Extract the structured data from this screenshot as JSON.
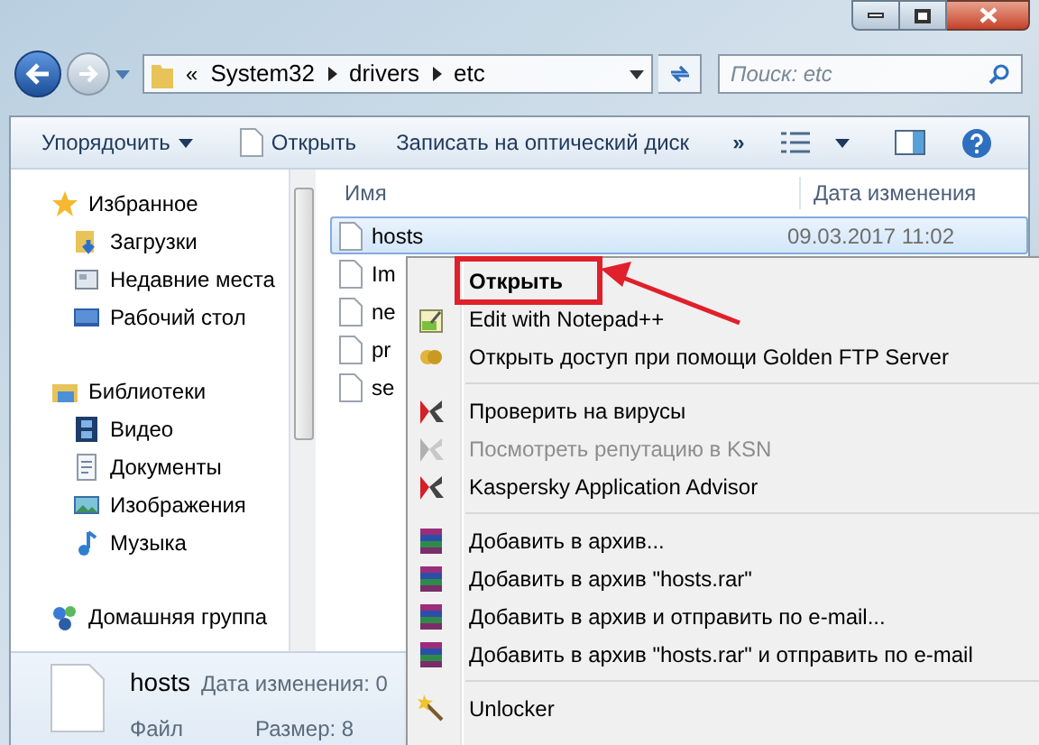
{
  "address": {
    "overflow": "«",
    "crumbs": [
      "System32",
      "drivers",
      "etc"
    ]
  },
  "search": {
    "placeholder": "Поиск: etc"
  },
  "toolbar": {
    "organize": "Упорядочить",
    "open": "Открыть",
    "burn": "Записать на оптический диск",
    "more": "»"
  },
  "sidebar": [
    {
      "label": "Избранное",
      "kind": "star",
      "children": [
        {
          "label": "Загрузки",
          "kind": "download"
        },
        {
          "label": "Недавние места",
          "kind": "recent"
        },
        {
          "label": "Рабочий стол",
          "kind": "desktop"
        }
      ]
    },
    {
      "label": "Библиотеки",
      "kind": "library",
      "children": [
        {
          "label": "Видео",
          "kind": "video"
        },
        {
          "label": "Документы",
          "kind": "doc"
        },
        {
          "label": "Изображения",
          "kind": "image"
        },
        {
          "label": "Музыка",
          "kind": "music"
        }
      ]
    },
    {
      "label": "Домашняя группа",
      "kind": "homegroup"
    }
  ],
  "columns": [
    "Имя",
    "Дата изменения"
  ],
  "files": [
    {
      "name": "hosts",
      "date": "09.03.2017 11:02",
      "selected": true
    },
    {
      "name": "Im",
      "selected": false
    },
    {
      "name": "ne",
      "selected": false
    },
    {
      "name": "pr",
      "selected": false
    },
    {
      "name": "se",
      "selected": false
    }
  ],
  "details": {
    "name": "hosts",
    "date_label": "Дата изменения: 0",
    "type": "Файл",
    "size_label": "Размер: 8"
  },
  "context_menu": [
    [
      {
        "label": "Открыть",
        "kind": "none",
        "default": true,
        "highlighted": true,
        "disabled": false
      },
      {
        "label": "Edit with Notepad++",
        "kind": "notepad",
        "default": false,
        "highlighted": false,
        "disabled": false
      },
      {
        "label": "Открыть доступ при помощи Golden FTP Server",
        "kind": "ftp",
        "default": false,
        "highlighted": false,
        "disabled": false
      }
    ],
    [
      {
        "label": "Проверить на вирусы",
        "kind": "kaspersky",
        "default": false,
        "highlighted": false,
        "disabled": false
      },
      {
        "label": "Посмотреть репутацию в KSN",
        "kind": "kaspersky",
        "default": false,
        "highlighted": false,
        "disabled": true
      },
      {
        "label": "Kaspersky Application Advisor",
        "kind": "kaspersky",
        "default": false,
        "highlighted": false,
        "disabled": false
      }
    ],
    [
      {
        "label": "Добавить в архив...",
        "kind": "archive",
        "default": false,
        "highlighted": false,
        "disabled": false
      },
      {
        "label": "Добавить в архив \"hosts.rar\"",
        "kind": "archive",
        "default": false,
        "highlighted": false,
        "disabled": false
      },
      {
        "label": "Добавить в архив и отправить по e-mail...",
        "kind": "archive",
        "default": false,
        "highlighted": false,
        "disabled": false
      },
      {
        "label": "Добавить в архив \"hosts.rar\" и отправить по e-mail",
        "kind": "archive",
        "default": false,
        "highlighted": false,
        "disabled": false
      }
    ],
    [
      {
        "label": "Unlocker",
        "kind": "wand",
        "default": false,
        "highlighted": false,
        "disabled": false
      }
    ]
  ]
}
